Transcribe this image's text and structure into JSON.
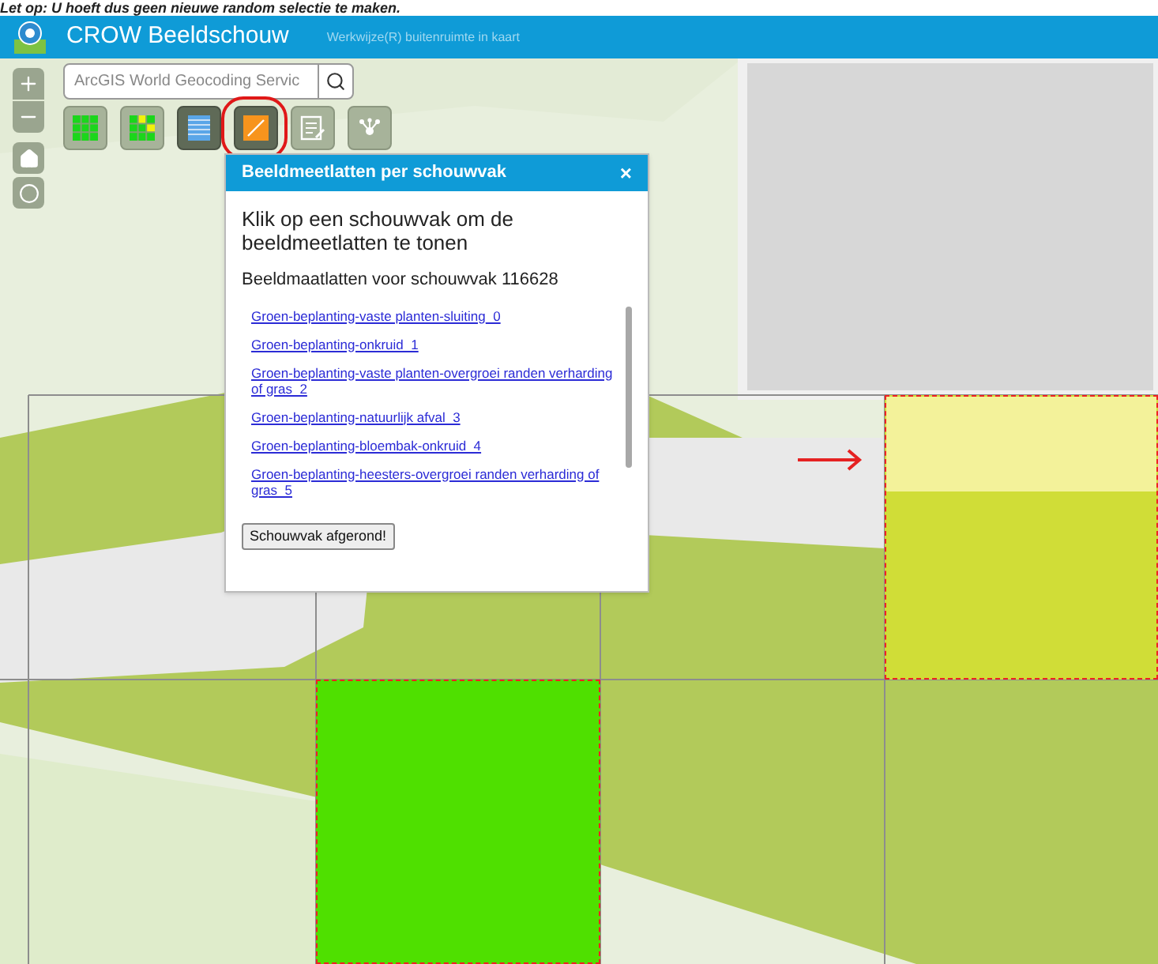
{
  "caption": "Let op: U hoeft dus geen nieuwe random selectie te maken.",
  "header": {
    "title": "CROW Beeldschouw",
    "subtitle": "Werkwijze(R) buitenruimte in kaart"
  },
  "search": {
    "placeholder": "ArcGIS World Geocoding Servic"
  },
  "tools": [
    {
      "kind": "grid",
      "selected": false,
      "circled": false
    },
    {
      "kind": "mixed",
      "selected": false,
      "circled": false
    },
    {
      "kind": "list",
      "selected": true,
      "circled": false
    },
    {
      "kind": "crow",
      "selected": true,
      "circled": true
    },
    {
      "kind": "edit",
      "selected": false,
      "circled": false
    },
    {
      "kind": "network",
      "selected": false,
      "circled": false
    }
  ],
  "popup": {
    "title": "Beeldmeetlatten per schouwvak",
    "close": "×",
    "intro": "Klik op een schouwvak om de beeldmeetlatten te tonen",
    "heading": "Beeldmaatlatten voor schouwvak 116628",
    "links": [
      "Groen-beplanting-vaste planten-sluiting_0",
      "Groen-beplanting-onkruid_1",
      "Groen-beplanting-vaste planten-overgroei randen verharding of gras_2",
      "Groen-beplanting-natuurlijk afval_3",
      "Groen-beplanting-bloembak-onkruid_4",
      "Groen-beplanting-heesters-overgroei randen verharding of gras_5"
    ],
    "button": "Schouwvak afgerond!"
  }
}
